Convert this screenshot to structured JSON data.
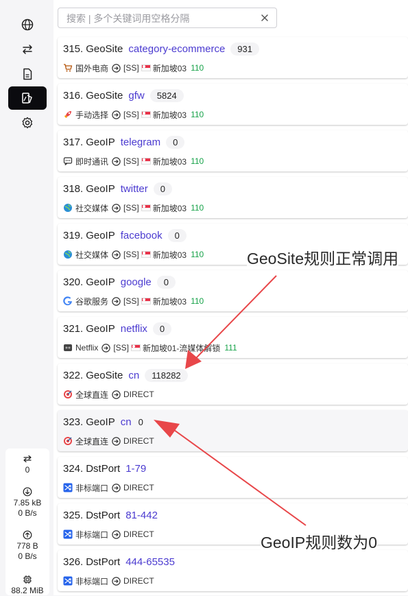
{
  "search": {
    "placeholder": "搜索 | 多个关键词用空格分隔"
  },
  "sidebar": {
    "nav": [
      {
        "name": "nav-proxies",
        "icon": "globe-icon",
        "active": false
      },
      {
        "name": "nav-connections",
        "icon": "swap-icon",
        "active": false
      },
      {
        "name": "nav-logs",
        "icon": "document-icon",
        "active": false
      },
      {
        "name": "nav-rules",
        "icon": "rules-icon",
        "active": true
      },
      {
        "name": "nav-settings",
        "icon": "gear-icon",
        "active": false
      }
    ],
    "stats": {
      "connections": "0",
      "download_total": "7.85 kB",
      "download_speed": "0 B/s",
      "upload_total": "778 B",
      "upload_speed": "0 B/s",
      "memory": "88.2 MiB"
    }
  },
  "rules": [
    {
      "index": "315.",
      "type": "GeoSite",
      "payload": "category-ecommerce",
      "count": "931",
      "group_icon": "cart-icon",
      "group": "国外电商",
      "proxy": "[SS]",
      "flag": "singapore-flag-icon",
      "node": "新加坡03",
      "delay": "110",
      "highlight": false
    },
    {
      "index": "316.",
      "type": "GeoSite",
      "payload": "gfw",
      "count": "5824",
      "group_icon": "rocket-icon",
      "group": "手动选择",
      "proxy": "[SS]",
      "flag": "singapore-flag-icon",
      "node": "新加坡03",
      "delay": "110",
      "highlight": false
    },
    {
      "index": "317.",
      "type": "GeoIP",
      "payload": "telegram",
      "count": "0",
      "group_icon": "chat-icon",
      "group": "即时通讯",
      "proxy": "[SS]",
      "flag": "singapore-flag-icon",
      "node": "新加坡03",
      "delay": "110",
      "highlight": false
    },
    {
      "index": "318.",
      "type": "GeoIP",
      "payload": "twitter",
      "count": "0",
      "group_icon": "globe-social-icon",
      "group": "社交媒体",
      "proxy": "[SS]",
      "flag": "singapore-flag-icon",
      "node": "新加坡03",
      "delay": "110",
      "highlight": false
    },
    {
      "index": "319.",
      "type": "GeoIP",
      "payload": "facebook",
      "count": "0",
      "group_icon": "globe-social-icon",
      "group": "社交媒体",
      "proxy": "[SS]",
      "flag": "singapore-flag-icon",
      "node": "新加坡03",
      "delay": "110",
      "highlight": false
    },
    {
      "index": "320.",
      "type": "GeoIP",
      "payload": "google",
      "count": "0",
      "group_icon": "google-icon",
      "group": "谷歌服务",
      "proxy": "[SS]",
      "flag": "singapore-flag-icon",
      "node": "新加坡03",
      "delay": "110",
      "highlight": false
    },
    {
      "index": "321.",
      "type": "GeoIP",
      "payload": "netflix",
      "count": "0",
      "group_icon": "netflix-icon",
      "group": "Netflix",
      "proxy": "[SS]",
      "flag": "singapore-flag-icon",
      "node": "新加坡01-流媒体解锁",
      "delay": "111",
      "highlight": false
    },
    {
      "index": "322.",
      "type": "GeoSite",
      "payload": "cn",
      "count": "118282",
      "group_icon": "target-icon",
      "group": "全球直连",
      "proxy": "DIRECT",
      "flag": "",
      "node": "",
      "delay": "",
      "highlight": false
    },
    {
      "index": "323.",
      "type": "GeoIP",
      "payload": "cn",
      "count": "0",
      "group_icon": "target-icon",
      "group": "全球直连",
      "proxy": "DIRECT",
      "flag": "",
      "node": "",
      "delay": "",
      "highlight": true
    },
    {
      "index": "324.",
      "type": "DstPort",
      "payload": "1-79",
      "count": "",
      "group_icon": "shuffle-icon",
      "group": "非标端口",
      "proxy": "DIRECT",
      "flag": "",
      "node": "",
      "delay": "",
      "highlight": false
    },
    {
      "index": "325.",
      "type": "DstPort",
      "payload": "81-442",
      "count": "",
      "group_icon": "shuffle-icon",
      "group": "非标端口",
      "proxy": "DIRECT",
      "flag": "",
      "node": "",
      "delay": "",
      "highlight": false
    },
    {
      "index": "326.",
      "type": "DstPort",
      "payload": "444-65535",
      "count": "",
      "group_icon": "shuffle-icon",
      "group": "非标端口",
      "proxy": "DIRECT",
      "flag": "",
      "node": "",
      "delay": "",
      "highlight": false
    }
  ],
  "annotations": {
    "geosite_note": "GeoSite规则正常调用",
    "geoip_note": "GeoIP规则数为0",
    "arrow_color": "#e8474a"
  },
  "colors": {
    "payload": "#4b3bd0",
    "delay": "#18a34a",
    "active_nav": "#0b0b0f"
  }
}
